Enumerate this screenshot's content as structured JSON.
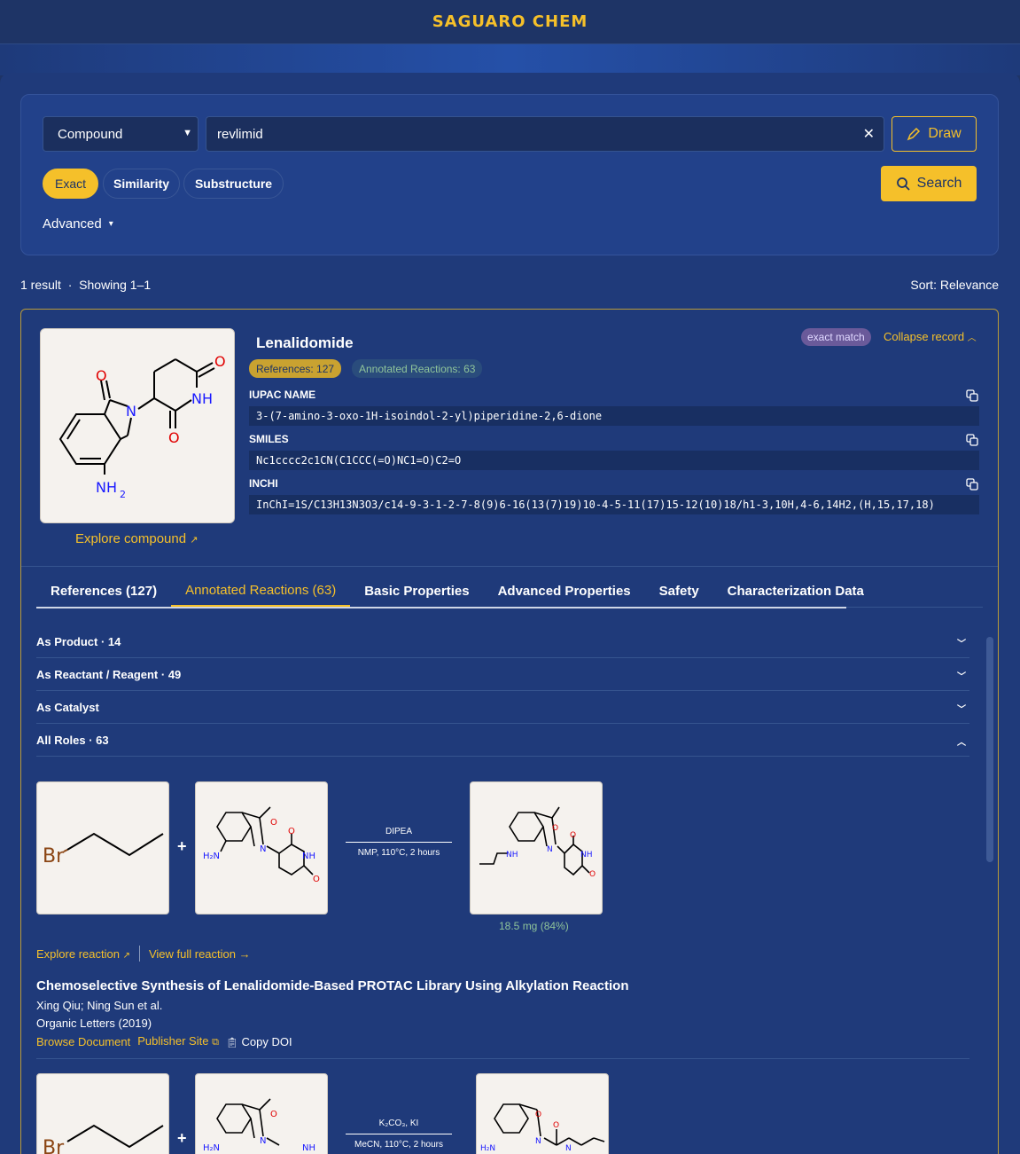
{
  "app": {
    "logo": "SAGUARO CHEM"
  },
  "search": {
    "type_value": "Compound",
    "query_value": "revlimid",
    "draw_label": "Draw",
    "modes": [
      "Exact",
      "Similarity",
      "Substructure"
    ],
    "search_label": "Search",
    "advanced_label": "Advanced"
  },
  "results": {
    "count_label": "1 result",
    "showing_label": "Showing 1–1",
    "sort_label": "Sort: Relevance"
  },
  "record": {
    "name": "Lenalidomide",
    "references_badge": "References: 127",
    "reactions_badge": "Annotated Reactions: 63",
    "exact_match": "exact match",
    "collapse_label": "Collapse record",
    "explore_label": "Explore compound",
    "iupac_label": "IUPAC NAME",
    "iupac_value": "3-(7-amino-3-oxo-1H-isoindol-2-yl)piperidine-2,6-dione",
    "smiles_label": "SMILES",
    "smiles_value": "Nc1cccc2c1CN(C1CCC(=O)NC1=O)C2=O",
    "inchi_label": "INCHI",
    "inchi_value": "InChI=1S/C13H13N3O3/c14-9-3-1-2-7-8(9)6-16(13(7)19)10-4-5-11(17)15-12(10)18/h1-3,10H,4-6,14H2,(H,15,17,18)",
    "mol_labels": {
      "o1": "O",
      "o2": "O",
      "o3": "O",
      "n": "N",
      "nh": "NH",
      "nh2": "NH",
      "sub2": "2"
    }
  },
  "tabs": [
    "References (127)",
    "Annotated Reactions (63)",
    "Basic Properties",
    "Advanced Properties",
    "Safety",
    "Characterization Data"
  ],
  "accordion": [
    {
      "label": "As Product · 14"
    },
    {
      "label": "As Reactant / Reagent · 49"
    },
    {
      "label": "As Catalyst"
    },
    {
      "label": "All Roles · 63"
    }
  ],
  "reactions": [
    {
      "reagent_label": "Br",
      "conditions_top": "DIPEA",
      "conditions_bottom": "NMP, 110°C, 2 hours",
      "yield": "18.5 mg (84%)",
      "explore_label": "Explore reaction",
      "full_label": "View full reaction",
      "doc_title": "Chemoselective Synthesis of Lenalidomide-Based PROTAC Library Using Alkylation Reaction",
      "authors": "Xing Qiu; Ning Sun et al.",
      "journal": "Organic Letters (2019)",
      "browse_label": "Browse Document",
      "publisher_label": "Publisher Site",
      "copy_doi_label": "Copy DOI"
    },
    {
      "reagent_label": "Br",
      "conditions_top": "K₂CO₃, KI",
      "conditions_bottom": "MeCN, 110°C, 2 hours"
    }
  ],
  "mini_labels": {
    "h2n": "H₂N",
    "o": "O",
    "n": "N",
    "nh": "NH"
  }
}
